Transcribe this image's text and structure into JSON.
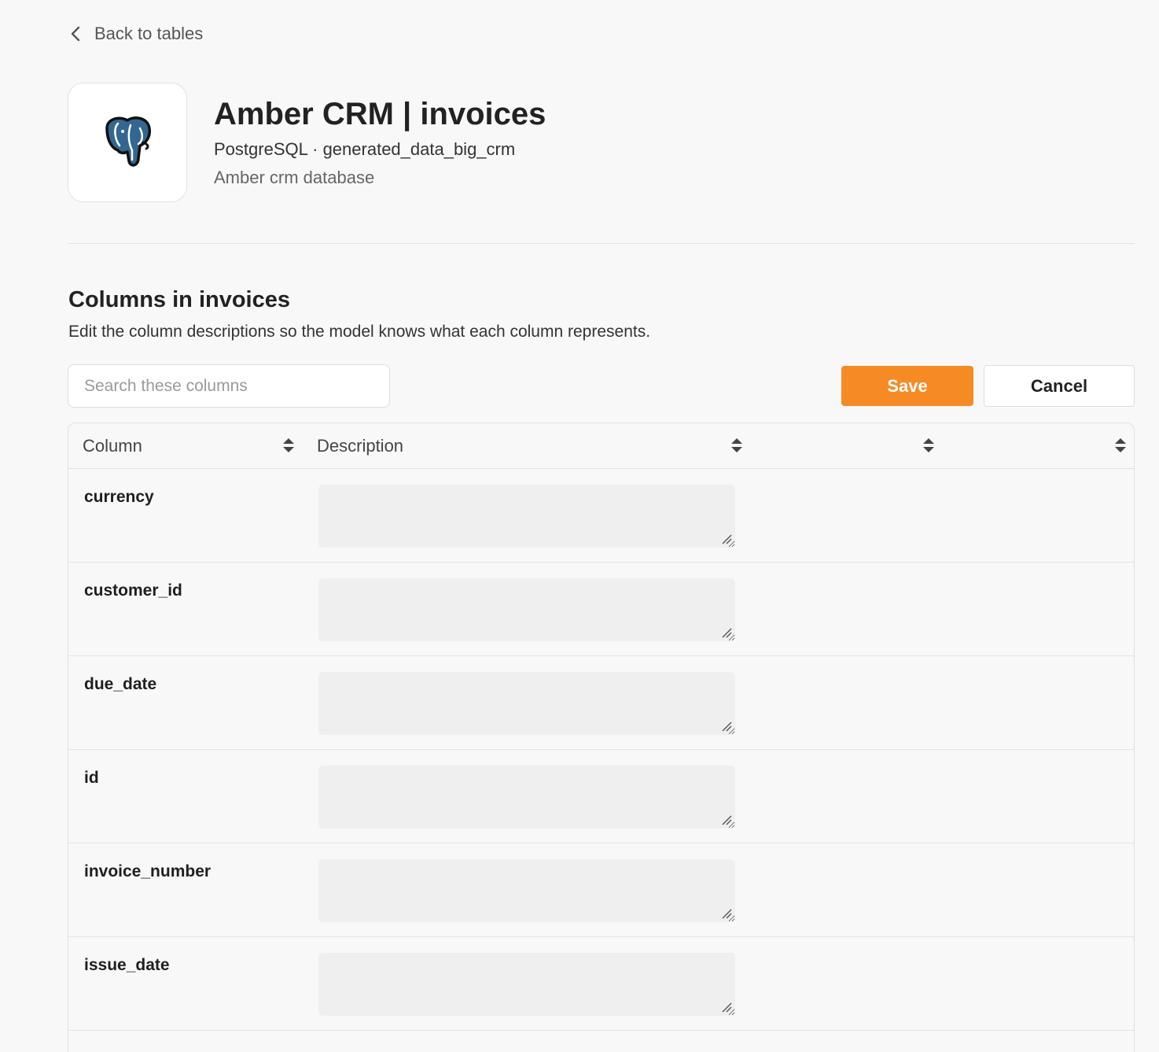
{
  "nav": {
    "back_label": "Back to tables"
  },
  "header": {
    "logo_icon": "postgresql-elephant-icon",
    "title": "Amber CRM | invoices",
    "subtitle": "PostgreSQL · generated_data_big_crm",
    "description": "Amber crm database"
  },
  "section": {
    "title": "Columns in invoices",
    "description": "Edit the column descriptions so the model knows what each column represents."
  },
  "search": {
    "placeholder": "Search these columns",
    "value": ""
  },
  "actions": {
    "save_label": "Save",
    "cancel_label": "Cancel"
  },
  "colors": {
    "accent": "#f68a24",
    "background": "#f8f8f8",
    "field_background": "#efefef",
    "postgres_blue": "#336791"
  },
  "table": {
    "headers": [
      "Column",
      "Description",
      "",
      ""
    ],
    "rows": [
      {
        "column": "currency",
        "description": ""
      },
      {
        "column": "customer_id",
        "description": ""
      },
      {
        "column": "due_date",
        "description": ""
      },
      {
        "column": "id",
        "description": ""
      },
      {
        "column": "invoice_number",
        "description": ""
      },
      {
        "column": "issue_date",
        "description": ""
      }
    ]
  }
}
